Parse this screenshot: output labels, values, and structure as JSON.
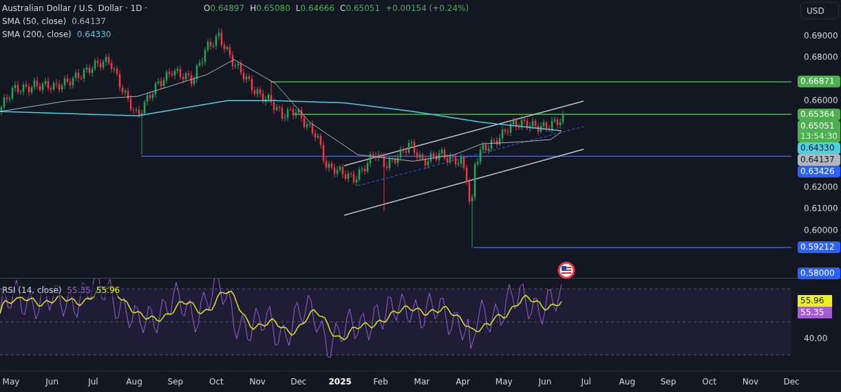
{
  "legend": {
    "symbol": "Australian Dollar / U.S. Dollar · 1D ·",
    "ohlc": [
      {
        "label": "O",
        "value": "0.64897"
      },
      {
        "label": "H",
        "value": "0.65080"
      },
      {
        "label": "L",
        "value": "0.64666"
      },
      {
        "label": "C",
        "value": "0.65051"
      }
    ],
    "change": "+0.00154 (+0.24%)"
  },
  "indicators": [
    {
      "name": "SMA (50, close)",
      "value": "0.64137",
      "color": "#b2b5be"
    },
    {
      "name": "SMA (200, close)",
      "value": "0.64330",
      "color": "#4dd0e1"
    }
  ],
  "currency_button": "USD",
  "price_axis": {
    "ticks": [
      "0.69000",
      "0.68000",
      "0.66000",
      "0.62000",
      "0.61000",
      "0.60000"
    ],
    "badges": [
      {
        "value": "0.66871",
        "color": "#4caf50"
      },
      {
        "value": "0.65364",
        "color": "#4caf50"
      },
      {
        "value": "0.65051",
        "countdown": "13:54:30",
        "color": "#4caf50"
      },
      {
        "value": "0.64330",
        "color": "#4dd0e1"
      },
      {
        "value": "0.64137",
        "color": "#b2b5be"
      },
      {
        "value": "0.63426",
        "color": "#2962ff"
      },
      {
        "value": "0.59212",
        "color": "#2962ff"
      },
      {
        "value": "0.58000",
        "color": "#2962ff"
      }
    ]
  },
  "rsi": {
    "name": "RSI (14, close)",
    "values": [
      {
        "value": "55.35",
        "color": "#9c5fd6"
      },
      {
        "value": "55.96",
        "color": "#e0e721"
      }
    ],
    "ticks": [
      "40.00"
    ],
    "badges": [
      {
        "value": "55.96",
        "color": "#ecf01e"
      },
      {
        "value": "55.35",
        "color": "#a55dd6"
      }
    ]
  },
  "time_axis": [
    {
      "label": "May",
      "bold": false
    },
    {
      "label": "Jun",
      "bold": false
    },
    {
      "label": "Jul",
      "bold": false
    },
    {
      "label": "Aug",
      "bold": false
    },
    {
      "label": "Sep",
      "bold": false
    },
    {
      "label": "Oct",
      "bold": false
    },
    {
      "label": "Nov",
      "bold": false
    },
    {
      "label": "Dec",
      "bold": false
    },
    {
      "label": "2025",
      "bold": true
    },
    {
      "label": "Feb",
      "bold": false
    },
    {
      "label": "Mar",
      "bold": false
    },
    {
      "label": "Apr",
      "bold": false
    },
    {
      "label": "May",
      "bold": false
    },
    {
      "label": "Jun",
      "bold": false
    },
    {
      "label": "Jul",
      "bold": false
    },
    {
      "label": "Aug",
      "bold": false
    },
    {
      "label": "Sep",
      "bold": false
    },
    {
      "label": "Oct",
      "bold": false
    },
    {
      "label": "Nov",
      "bold": false
    },
    {
      "label": "Dec",
      "bold": false
    }
  ]
}
